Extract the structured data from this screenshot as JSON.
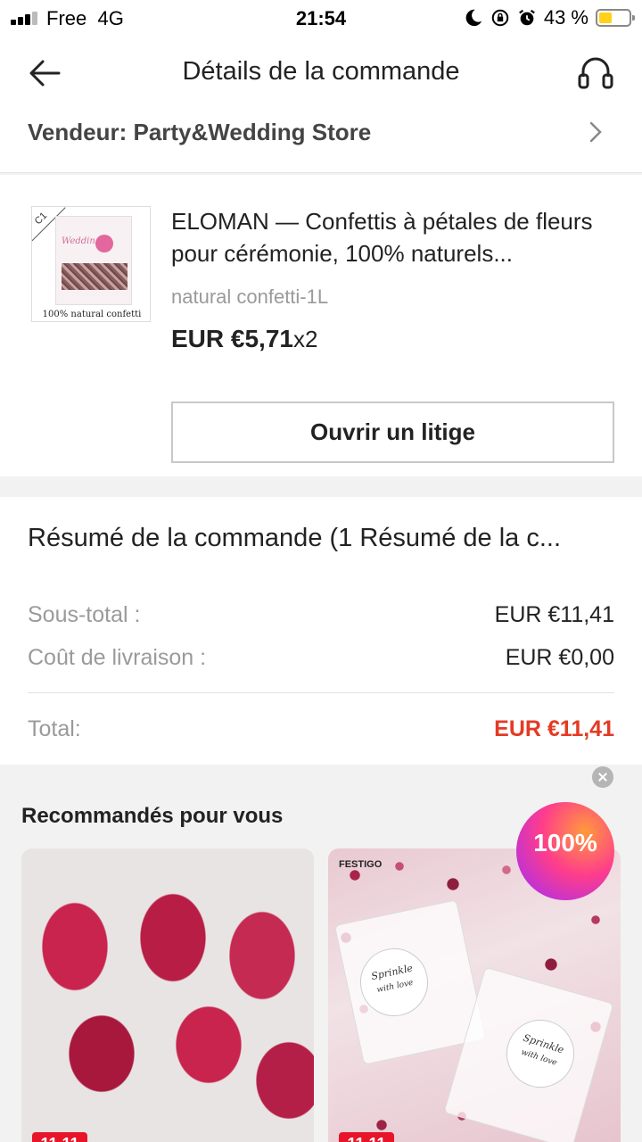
{
  "status_bar": {
    "carrier": "Free",
    "network": "4G",
    "time": "21:54",
    "battery_percent": "43 %",
    "battery_level": 0.43,
    "icons": [
      "signal-icon",
      "moon-icon",
      "rotation-lock-icon",
      "alarm-icon",
      "battery-icon"
    ]
  },
  "header": {
    "title": "Détails de la commande",
    "icons": [
      "back-arrow-icon",
      "headset-icon"
    ]
  },
  "seller": {
    "label": "Vendeur: Party&Wedding Store"
  },
  "product": {
    "image_caption": "100% natural confetti",
    "image_tag": "C1",
    "image_brand": "Wedding",
    "title": "ELOMAN — Confettis à pétales de fleurs pour cérémonie, 100% naturels...",
    "variant": "natural confetti-1L",
    "price": "EUR €5,71",
    "quantity": "x2",
    "dispute_button": "Ouvrir un litige"
  },
  "summary": {
    "title": "Résumé de la commande (1 Résumé de la c...",
    "subtotal_label": "Sous-total :",
    "subtotal_value": "EUR €11,41",
    "shipping_label": "Coût de livraison :",
    "shipping_value": "EUR €0,00",
    "total_label": "Total:",
    "total_value": "EUR €11,41",
    "total_color": "#e43a24"
  },
  "recommendations": {
    "title": "Recommandés pour vous",
    "promo_badge": "100%",
    "items": [
      {
        "sale_tag": "11.11"
      },
      {
        "sale_tag": "11.11",
        "brand": "FESTIGO",
        "tag_text": "Sprinkle",
        "tag_sub": "with love"
      }
    ]
  }
}
